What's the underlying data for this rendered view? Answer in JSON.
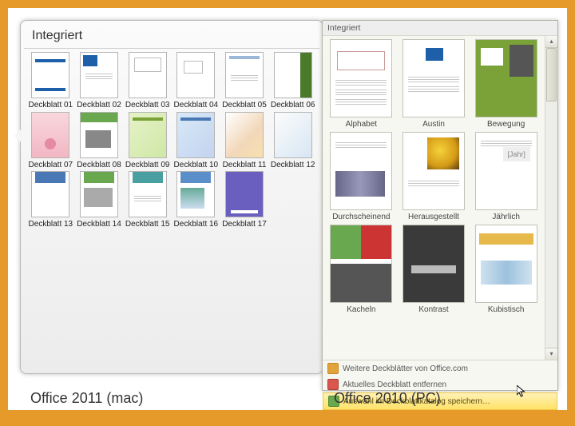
{
  "mac": {
    "title": "Integriert",
    "items": [
      {
        "label": "Deckblatt 01",
        "deco": "m1"
      },
      {
        "label": "Deckblatt 02",
        "deco": "m2"
      },
      {
        "label": "Deckblatt 03",
        "deco": "m3"
      },
      {
        "label": "Deckblatt 04",
        "deco": "m4"
      },
      {
        "label": "Deckblatt 05",
        "deco": "m5"
      },
      {
        "label": "Deckblatt 06",
        "deco": "m6"
      },
      {
        "label": "Deckblatt 07",
        "deco": "m7"
      },
      {
        "label": "Deckblatt 08",
        "deco": "m8"
      },
      {
        "label": "Deckblatt 09",
        "deco": "m9"
      },
      {
        "label": "Deckblatt 10",
        "deco": "m10"
      },
      {
        "label": "Deckblatt 11",
        "deco": "m11"
      },
      {
        "label": "Deckblatt 12",
        "deco": "m12"
      },
      {
        "label": "Deckblatt 13",
        "deco": "m13"
      },
      {
        "label": "Deckblatt 14",
        "deco": "m14"
      },
      {
        "label": "Deckblatt 15",
        "deco": "m15"
      },
      {
        "label": "Deckblatt 16",
        "deco": "m16"
      },
      {
        "label": "Deckblatt 17",
        "deco": "m17"
      }
    ]
  },
  "pc": {
    "title": "Integriert",
    "items": [
      {
        "label": "Alphabet",
        "deco": "p1"
      },
      {
        "label": "Austin",
        "deco": "p2"
      },
      {
        "label": "Bewegung",
        "deco": "p3"
      },
      {
        "label": "Durchscheinend",
        "deco": "p4"
      },
      {
        "label": "Herausgestellt",
        "deco": "p5"
      },
      {
        "label": "Jährlich",
        "deco": "p6"
      },
      {
        "label": "Kacheln",
        "deco": "p7"
      },
      {
        "label": "Kontrast",
        "deco": "p8"
      },
      {
        "label": "Kubistisch",
        "deco": "p9"
      }
    ],
    "footer": {
      "more": "Weitere Deckblätter von Office.com",
      "remove": "Aktuelles Deckblatt entfernen",
      "save": "Auswahl im Deckblattkatalog speichern…"
    }
  },
  "captions": {
    "mac": "Office 2011  (mac)",
    "pc": "Office 2010 (PC)"
  }
}
